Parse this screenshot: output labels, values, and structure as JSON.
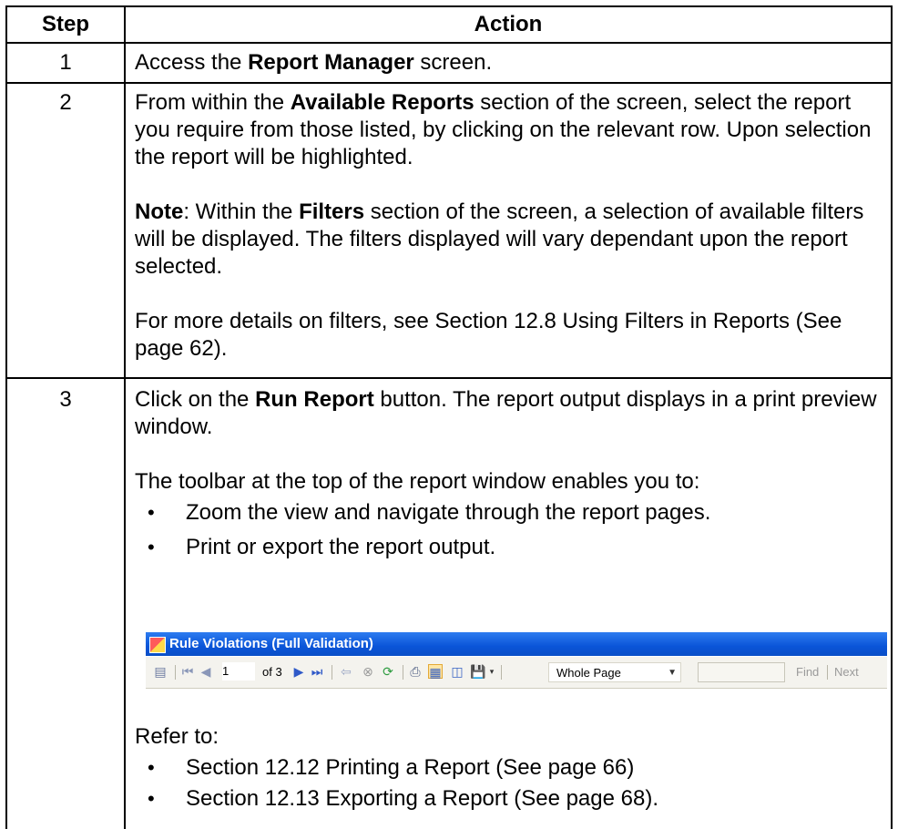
{
  "table": {
    "headers": {
      "step": "Step",
      "action": "Action"
    },
    "rows": [
      {
        "step": "1",
        "action": {
          "pre": "Access the ",
          "bold": "Report Manager",
          "post": " screen."
        }
      },
      {
        "step": "2",
        "action": {
          "p1_pre": "From within the ",
          "p1_bold": "Available Reports",
          "p1_post": " section of the screen, select the report you require from those listed, by clicking on the relevant row. Upon selection the report will be highlighted.",
          "note_label": "Note",
          "note_pre": ": Within the ",
          "note_bold": "Filters",
          "note_post": " section of the screen, a selection of available filters will be displayed. The filters displayed will vary dependant upon the report selected.",
          "p3": "For more details on filters, see Section 12.8 Using Filters in Reports (See page 62)."
        }
      },
      {
        "step": "3",
        "action": {
          "p1_pre": "Click on the ",
          "p1_bold": "Run Report",
          "p1_post": " button. The report output displays in a print preview window.",
          "p2": "The toolbar at the top of the report window enables you to:",
          "bullets": [
            "Zoom the view and navigate through the report pages.",
            "Print or export the report output."
          ],
          "screenshot": {
            "window_title": "Rule Violations (Full Validation)",
            "page_current": "1",
            "page_of": "of 3",
            "zoom_value": "Whole Page",
            "find_label": "Find",
            "next_label": "Next"
          },
          "refer_label": "Refer to:",
          "refer_bullets": [
            "Section 12.12 Printing a Report (See page 66)",
            "Section 12.13 Exporting a Report (See page 68)."
          ]
        }
      }
    ]
  }
}
